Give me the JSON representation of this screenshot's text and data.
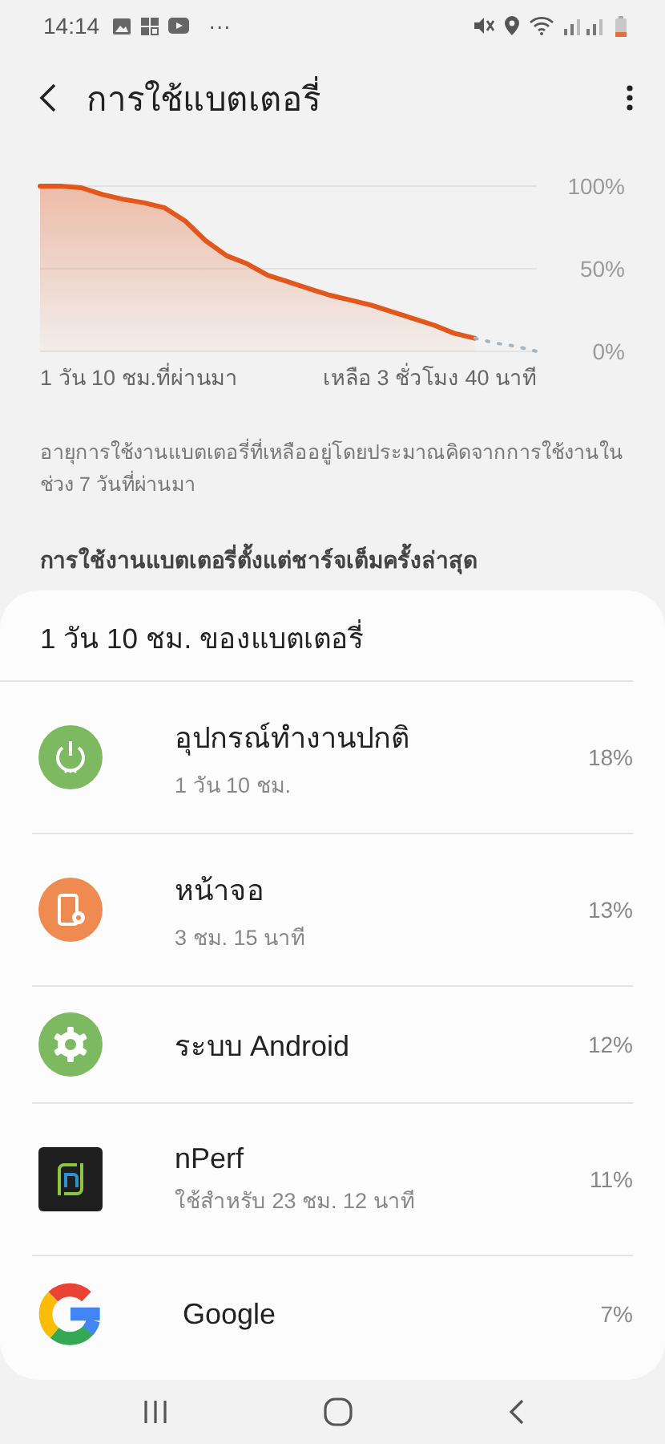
{
  "status_bar": {
    "time": "14:14",
    "more": "···"
  },
  "header": {
    "title": "การใช้แบตเตอรี่"
  },
  "usage_chart": {
    "chart_data": {
      "type": "area",
      "ylim": [
        0,
        100
      ],
      "yticks": [
        {
          "value": 0,
          "label": "0%"
        },
        {
          "value": 50,
          "label": "50%"
        },
        {
          "value": 100,
          "label": "100%"
        }
      ],
      "categories": [
        null,
        null,
        null,
        null,
        null,
        null,
        null,
        null,
        null,
        null,
        null,
        null,
        null,
        null,
        null,
        null,
        null,
        null,
        null,
        null,
        null,
        null,
        null,
        null,
        null
      ],
      "series": [
        {
          "color": "#e2581c",
          "values": [
            100,
            100,
            99,
            95,
            92,
            90,
            87,
            79,
            67,
            58,
            53,
            46,
            42,
            38,
            34,
            31,
            28,
            24,
            20,
            16,
            11,
            8,
            null,
            null,
            null
          ]
        },
        {
          "type": "line",
          "line_style": "dotted",
          "color": "#a9b4bc",
          "values": [
            null,
            null,
            null,
            null,
            null,
            null,
            null,
            null,
            null,
            null,
            null,
            null,
            null,
            null,
            null,
            null,
            null,
            null,
            null,
            null,
            null,
            8,
            5,
            3,
            0
          ]
        }
      ]
    },
    "start_label": "1 วัน 10 ชม.ที่ผ่านมา",
    "end_label": "เหลือ 3 ชั่วโมง 40 นาที"
  },
  "note": "อายุการใช้งานแบตเตอรี่ที่เหลืออยู่โดยประมาณคิดจากการใช้งานใน ช่วง 7 วันที่ผ่านมา",
  "section_title": "การใช้งานแบตเตอรี่ตั้งแต่ชาร์จเต็มครั้งล่าสุด",
  "usage_card": {
    "title": "1 วัน 10 ชม. ของแบตเตอรี่",
    "items": [
      {
        "kind": "power",
        "name": "อุปกรณ์ทำงานปกติ",
        "detail": "1 วัน 10 ชม.",
        "percent": "18%"
      },
      {
        "kind": "screen",
        "name": "หน้าจอ",
        "detail": "3 ชม. 15 นาที",
        "percent": "13%"
      },
      {
        "kind": "gear",
        "name": "ระบบ Android",
        "percent": "12%"
      },
      {
        "kind": "app",
        "name": "nPerf",
        "detail": "ใช้สำหรับ 23 ชม. 12 นาที",
        "percent": "11%"
      },
      {
        "kind": "google",
        "name": "Google",
        "percent": "7%"
      }
    ]
  },
  "nav_bar": [
    {
      "kind": "recents"
    },
    {
      "kind": "home"
    },
    {
      "kind": "back"
    }
  ]
}
